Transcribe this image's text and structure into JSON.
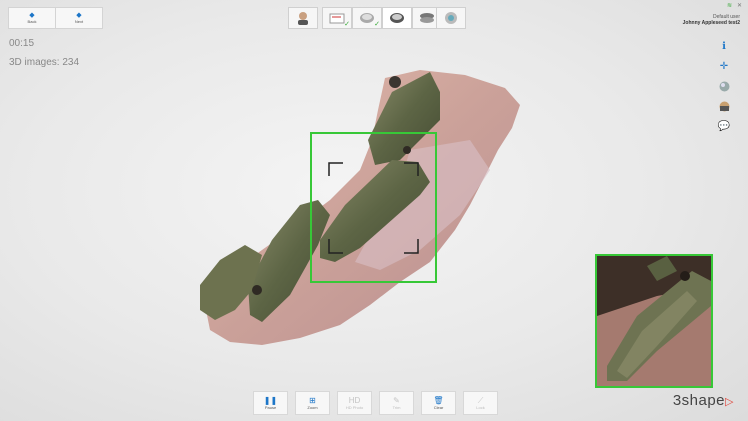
{
  "nav": {
    "back_label": "Back",
    "next_label": "Next"
  },
  "workflow": {
    "steps": [
      {
        "icon": "patient-icon",
        "done": false
      },
      {
        "icon": "order-icon",
        "done": true
      },
      {
        "icon": "upper-jaw-scan-icon",
        "done": true
      },
      {
        "icon": "lower-jaw-scan-icon",
        "done": false
      },
      {
        "icon": "bite-scan-icon",
        "done": false
      },
      {
        "icon": "analyze-icon",
        "done": false
      }
    ]
  },
  "user": {
    "role": "Default user",
    "name": "Johnny Appleseed test2"
  },
  "window": {
    "close": "✕"
  },
  "scan": {
    "timer": "00:15",
    "images_label": "3D images: 234"
  },
  "right_tools": [
    "info-icon",
    "move-icon",
    "color-sphere-icon",
    "texture-icon",
    "comment-icon"
  ],
  "toolbar": {
    "pause_label": "Pause",
    "zoom_label": "Zoom",
    "hd_photo_label": "HD Photo",
    "trim_label": "Trim",
    "clear_label": "Clear",
    "lock_label": "Lock"
  },
  "brand": {
    "name": "3shape"
  },
  "colors": {
    "accent": "#1d76c8",
    "scan_frame": "#37c837",
    "logo_accent": "#e0463c"
  }
}
